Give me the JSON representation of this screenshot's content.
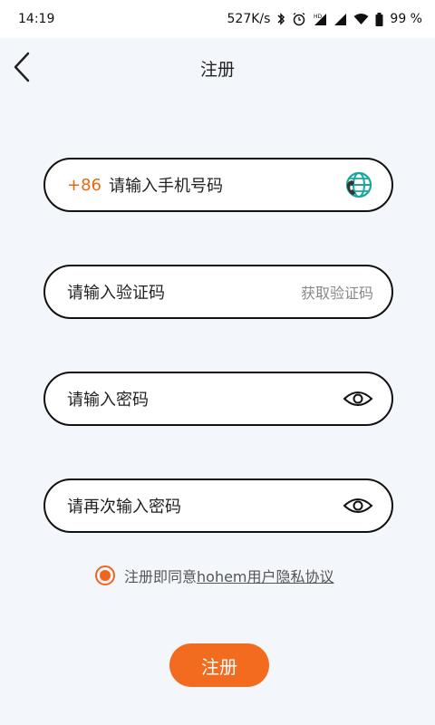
{
  "status_bar": {
    "time": "14:19",
    "net_speed": "527K/s",
    "battery": "99 %"
  },
  "header": {
    "title": "注册"
  },
  "form": {
    "phone": {
      "prefix": "+86",
      "placeholder": "请输入手机号码"
    },
    "code": {
      "placeholder": "请输入验证码",
      "action": "获取验证码"
    },
    "password": {
      "placeholder": "请输入密码"
    },
    "confirm": {
      "placeholder": "请再次输入密码"
    }
  },
  "agreement": {
    "prefix_text": "注册即同意",
    "link_text": "hohem用户隐私协议"
  },
  "submit_label": "注册",
  "colors": {
    "accent": "#f36b1f",
    "teal": "#1aa6a0"
  }
}
